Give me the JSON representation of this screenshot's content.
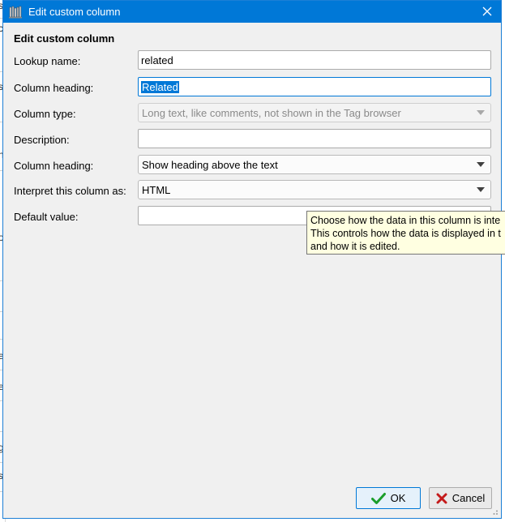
{
  "background_app": {
    "edge_chars": [
      "s",
      "c",
      "s",
      "n",
      "o",
      "e",
      "e",
      "g",
      "s"
    ]
  },
  "dialog": {
    "title": "Edit custom column",
    "section_title": "Edit custom column",
    "fields": {
      "lookup_name": {
        "label": "Lookup name:",
        "value": "related"
      },
      "column_heading": {
        "label": "Column heading:",
        "value": "Related"
      },
      "column_type": {
        "label": "Column type:",
        "value": "Long text, like comments, not shown in the Tag browser"
      },
      "description": {
        "label": "Description:",
        "value": ""
      },
      "column_heading_position": {
        "label": "Column heading:",
        "value": "Show heading above the text"
      },
      "interpret_as": {
        "label": "Interpret this column as:",
        "value": "HTML"
      },
      "default_value": {
        "label": "Default value:",
        "value": ""
      }
    },
    "tooltip": {
      "line1": "Choose how the data in this column is inte",
      "line2": "This controls how the data is displayed in t",
      "line3": "and how it is edited."
    },
    "buttons": {
      "ok": "OK",
      "cancel": "Cancel"
    }
  },
  "colors": {
    "titlebar": "#0078d7",
    "ok_icon": "#1a9e2a",
    "cancel_icon": "#c41a1a",
    "tooltip_bg": "#ffffe1"
  },
  "icons": {
    "title": "library-icon",
    "close": "close-icon",
    "ok": "checkmark-icon",
    "cancel": "x-icon",
    "dropdown": "chevron-down-icon"
  }
}
